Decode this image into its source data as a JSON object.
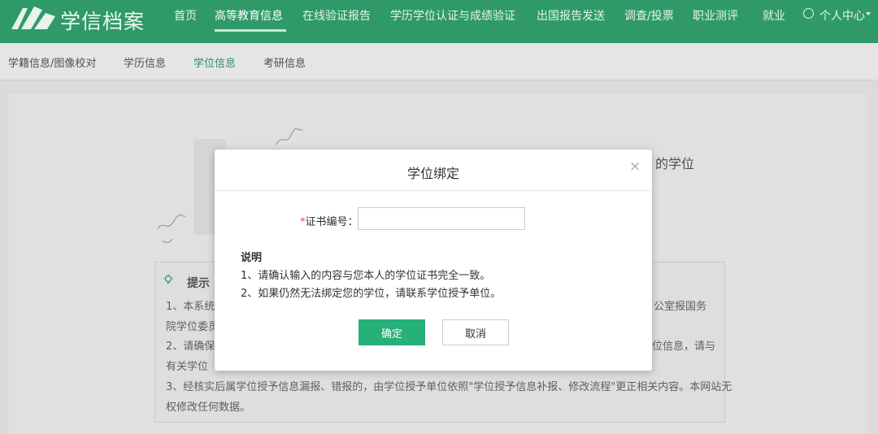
{
  "header": {
    "logo_text": "学信档案",
    "nav": [
      "首页",
      "高等教育信息",
      "在线验证报告",
      "学历学位认证与成绩验证",
      "出国报告发送",
      "调查/投票",
      "职业测评",
      "就业"
    ],
    "user_menu": "个人中心"
  },
  "subnav": [
    "学籍信息/图像校对",
    "学历信息",
    "学位信息",
    "考研信息"
  ],
  "background": {
    "title_tail": "的学位",
    "tip_title": "提示",
    "lines": [
      "1、本系统",
      "公室报国务",
      "院学位委员",
      "2、请确保",
      "位信息，请与",
      "有关学位",
      "3、经核实后属学位授予信息漏报、错报的，由学位授予单位依照\"学位授予信息补报、修改流程\"更正相关内容。本网站无",
      "权修改任何数据。"
    ]
  },
  "modal": {
    "title": "学位绑定",
    "close": "×",
    "required_mark": "*",
    "field_label": "证书编号：",
    "field_value": "",
    "note_title": "说明",
    "notes": [
      "1、请确认输入的内容与您本人的学位证书完全一致。",
      "2、如果仍然无法绑定您的学位，请联系学位授予单位。"
    ],
    "ok_label": "确定",
    "cancel_label": "取消"
  },
  "colors": {
    "brand": "#2f9a68",
    "primary_button": "#26b07a",
    "required": "#e24b4b"
  }
}
